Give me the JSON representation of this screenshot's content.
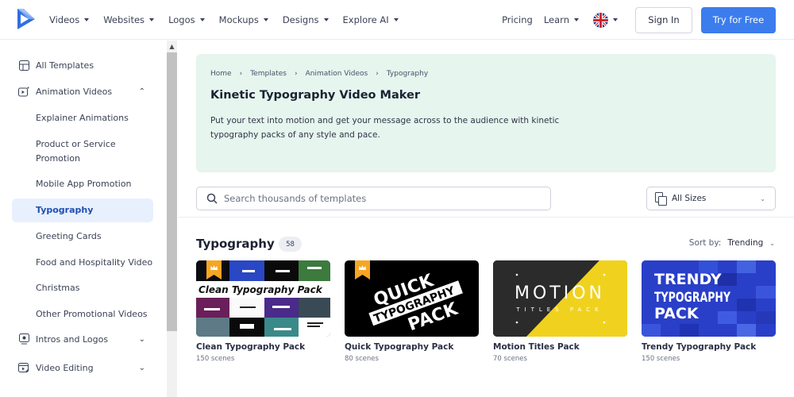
{
  "header": {
    "nav": [
      {
        "label": "Videos"
      },
      {
        "label": "Websites"
      },
      {
        "label": "Logos"
      },
      {
        "label": "Mockups"
      },
      {
        "label": "Designs"
      },
      {
        "label": "Explore AI"
      }
    ],
    "pricing": "Pricing",
    "learn": "Learn",
    "language_icon": "uk-flag-icon",
    "sign_in": "Sign In",
    "try_free": "Try for Free",
    "accent_color": "#3b7ded"
  },
  "sidebar": {
    "all_templates": "All Templates",
    "animation_videos": "Animation Videos",
    "sub_items": [
      {
        "label": "Explainer Animations"
      },
      {
        "label": "Product or Service Promotion"
      },
      {
        "label": "Mobile App Promotion"
      },
      {
        "label": "Typography",
        "active": true
      },
      {
        "label": "Greeting Cards"
      },
      {
        "label": "Food and Hospitality Video"
      },
      {
        "label": "Christmas"
      },
      {
        "label": "Other Promotional Videos"
      }
    ],
    "intros_logos": "Intros and Logos",
    "video_editing": "Video Editing"
  },
  "hero": {
    "breadcrumb": [
      "Home",
      "Templates",
      "Animation Videos",
      "Typography"
    ],
    "title": "Kinetic Typography Video Maker",
    "description": "Put your text into motion and get your message across to the audience with kinetic typography packs of any style and pace.",
    "background": "#e6f5ee"
  },
  "filters": {
    "search_placeholder": "Search thousands of templates",
    "sizes": "All Sizes"
  },
  "section": {
    "title": "Typography",
    "count": "58",
    "sort_label": "Sort by:",
    "sort_value": "Trending"
  },
  "cards": [
    {
      "title": "Clean Typography Pack",
      "scenes": "150 scenes",
      "thumb_text": "Clean Typography Pack",
      "premium": true
    },
    {
      "title": "Quick Typography Pack",
      "scenes": "80 scenes",
      "thumb_lines": [
        "QUICK",
        "TYPOGRAPHY",
        "PACK"
      ],
      "premium": true
    },
    {
      "title": "Motion Titles Pack",
      "scenes": "70 scenes",
      "thumb_lines": [
        "MOTION",
        "TITLES PACK"
      ],
      "premium": false
    },
    {
      "title": "Trendy Typography Pack",
      "scenes": "150 scenes",
      "thumb_lines": [
        "TRENDY",
        "TYPOGRAPHY",
        "PACK"
      ],
      "premium": false
    }
  ]
}
